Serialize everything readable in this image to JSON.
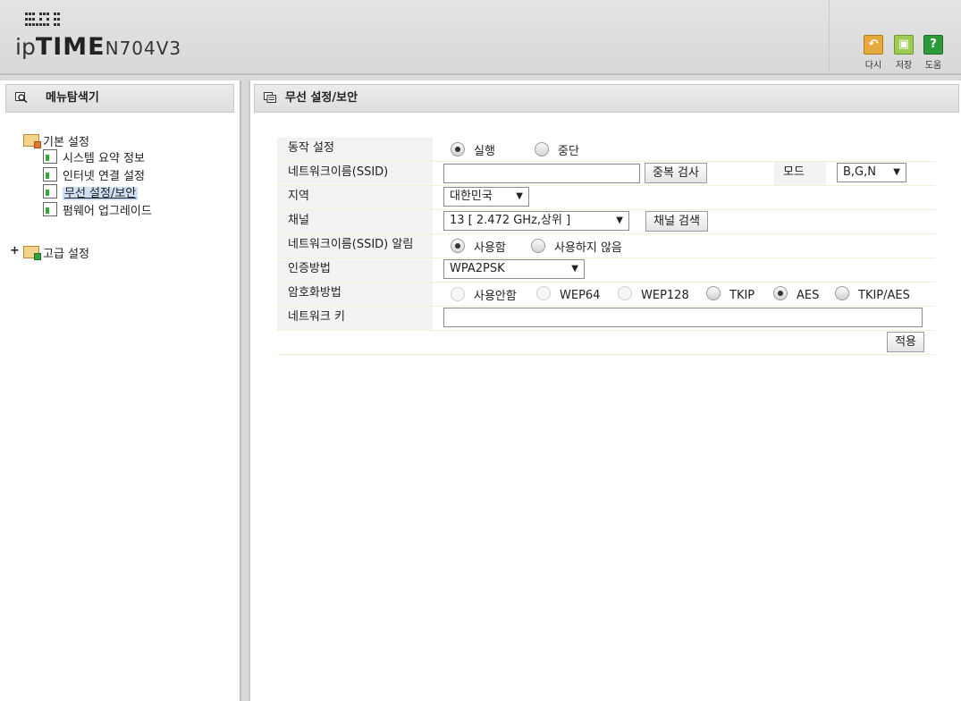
{
  "brand": {
    "prefix": "ip",
    "name": "TIME",
    "model": "N704V3"
  },
  "toolbar": {
    "reload": {
      "label": "다시",
      "icon": "reload-icon"
    },
    "save": {
      "label": "저장",
      "icon": "save-icon"
    },
    "help": {
      "label": "도움",
      "icon": "help-icon"
    }
  },
  "sidebar": {
    "title": "메뉴탐색기",
    "basic": {
      "label": "기본 설정",
      "items": [
        {
          "label": "시스템 요약 정보"
        },
        {
          "label": "인터넷 연결 설정"
        },
        {
          "label": "무선 설정/보안"
        },
        {
          "label": "펌웨어 업그레이드"
        }
      ]
    },
    "advanced": {
      "label": "고급 설정",
      "expander": "+"
    }
  },
  "main": {
    "title": "무선 설정/보안"
  },
  "form": {
    "operation": {
      "label": "동작 설정",
      "options": [
        "실행",
        "중단"
      ],
      "selected": "실행"
    },
    "ssid": {
      "label": "네트워크이름(SSID)",
      "value": "",
      "check_button": "중복 검사",
      "mode_label": "모드",
      "mode_value": "B,G,N"
    },
    "region": {
      "label": "지역",
      "value": "대한민국"
    },
    "channel": {
      "label": "채널",
      "value": "13 [ 2.472 GHz,상위 ]",
      "search_button": "채널 검색"
    },
    "broadcast": {
      "label": "네트워크이름(SSID) 알림",
      "options": [
        "사용함",
        "사용하지 않음"
      ],
      "selected": "사용함"
    },
    "auth": {
      "label": "인증방법",
      "value": "WPA2PSK"
    },
    "encryption": {
      "label": "암호화방법",
      "options": [
        "사용안함",
        "WEP64",
        "WEP128",
        "TKIP",
        "AES",
        "TKIP/AES"
      ],
      "selected": "AES"
    },
    "key": {
      "label": "네트워크 키",
      "value": ""
    },
    "apply_button": "적용"
  },
  "colors": {
    "highlight": "#cfe0f5",
    "label_bg": "#f3f3f3",
    "frame": "#d9d9d9"
  }
}
